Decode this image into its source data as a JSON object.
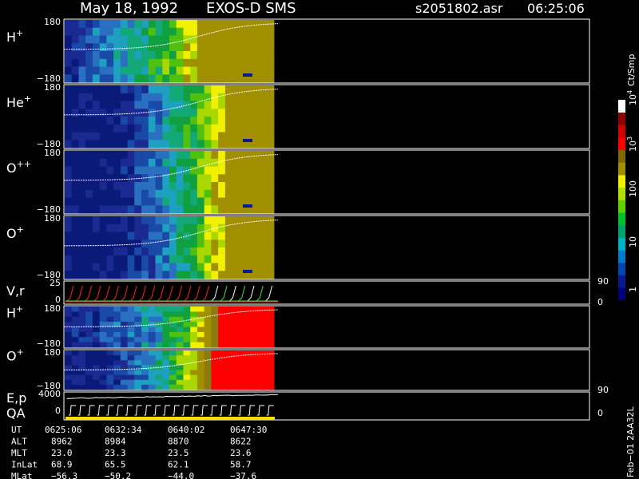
{
  "header": {
    "date": "May 18, 1992",
    "instrument": "EXOS-D SMS",
    "file": "s2051802.asr",
    "time": "06:25:06"
  },
  "chart_data": {
    "type": "heatmap",
    "panels": [
      {
        "label": "H",
        "sup": "+",
        "ymax": "180",
        "ymin": "−180",
        "levels": [
          1,
          1,
          2,
          2,
          3,
          3,
          3,
          4,
          4,
          4,
          5,
          5,
          6,
          6,
          7,
          7,
          8,
          9,
          9,
          10,
          10,
          10,
          10,
          10,
          10,
          10,
          10,
          10,
          10,
          10
        ]
      },
      {
        "label": "He",
        "sup": "+",
        "ymax": "180",
        "ymin": "−180",
        "levels": [
          0,
          0,
          0,
          0,
          0,
          0,
          0,
          0,
          1,
          1,
          2,
          2,
          3,
          3,
          4,
          5,
          5,
          6,
          6,
          7,
          8,
          9,
          9,
          10,
          10,
          10,
          10,
          10,
          10,
          10
        ]
      },
      {
        "label": "O",
        "sup": "++",
        "ymax": "180",
        "ymin": "−180",
        "levels": [
          0,
          0,
          0,
          0,
          0,
          0,
          0,
          0,
          1,
          1,
          2,
          2,
          3,
          3,
          4,
          5,
          5,
          6,
          6,
          7,
          8,
          9,
          9,
          10,
          10,
          10,
          10,
          10,
          10,
          10
        ]
      },
      {
        "label": "O",
        "sup": "+",
        "ymax": "180",
        "ymin": "−180",
        "levels": [
          0,
          0,
          0,
          0,
          0,
          0,
          0,
          0,
          0,
          1,
          1,
          2,
          2,
          3,
          3,
          4,
          5,
          5,
          6,
          7,
          8,
          9,
          9,
          10,
          10,
          10,
          10,
          10,
          10,
          10
        ]
      },
      {
        "label": "H",
        "sup": "+",
        "ymax": "180",
        "ymin": "−180",
        "levels": [
          0,
          1,
          1,
          2,
          1,
          2,
          2,
          3,
          2,
          3,
          3,
          4,
          3,
          4,
          5,
          6,
          6,
          7,
          8,
          9,
          10,
          11,
          12,
          12,
          12,
          12,
          12,
          12,
          12,
          12
        ]
      },
      {
        "label": "O",
        "sup": "+",
        "ymax": "180",
        "ymin": "−180",
        "levels": [
          0,
          0,
          0,
          0,
          0,
          0,
          1,
          1,
          2,
          2,
          3,
          3,
          4,
          5,
          5,
          6,
          7,
          8,
          9,
          10,
          11,
          12,
          12,
          12,
          12,
          12,
          12,
          12,
          12,
          12
        ]
      }
    ],
    "vr_panel": {
      "label": "V,r",
      "ymax": "25",
      "ymin": "0",
      "right_top": "90",
      "right_bottom": "0"
    },
    "ep_panel": {
      "label": "E,p",
      "sublabel": "QA",
      "ymax": "4000",
      "ymin": "0",
      "right_top": "90",
      "right_bottom": "0"
    },
    "colorbar": {
      "title": "Ct/Smp",
      "tick_labels": [
        "1",
        "10",
        "100",
        "10",
        "10"
      ],
      "tick_sups": [
        "",
        "",
        "",
        "3",
        "4"
      ],
      "colors": [
        "#00007a",
        "#0a1a90",
        "#0045b0",
        "#007bcc",
        "#00b2c8",
        "#00a070",
        "#00c030",
        "#60d000",
        "#b0e000",
        "#f0f000",
        "#a09000",
        "#806a00",
        "#ff0000",
        "#d00000",
        "#900000",
        "#ffffff"
      ]
    },
    "palette": [
      "#0a1a78",
      "#1a2a90",
      "#1a4aa8",
      "#2a70c0",
      "#1ea0c0",
      "#12a878",
      "#10a040",
      "#50c010",
      "#a8d800",
      "#f0f000",
      "#a09000",
      "#8a7a10",
      "#ff0000"
    ],
    "x_tick_labels": [
      "0625:06",
      "0632:34",
      "0640:02",
      "0647:30"
    ]
  },
  "footer": {
    "rows": [
      {
        "name": "UT",
        "values": [
          "0625:06",
          "0632:34",
          "0640:02",
          "0647:30"
        ]
      },
      {
        "name": "ALT",
        "values": [
          "8962",
          "8984",
          "8870",
          "8622"
        ]
      },
      {
        "name": "MLT",
        "values": [
          "23.0",
          "23.3",
          "23.5",
          "23.6"
        ]
      },
      {
        "name": "InLat",
        "values": [
          "68.9",
          "65.5",
          "62.1",
          "58.7"
        ]
      },
      {
        "name": "MLat",
        "values": [
          "−56.3",
          "−50.2",
          "−44.0",
          "−37.6"
        ]
      }
    ],
    "sideline": "Feb−01 2AA32L"
  }
}
